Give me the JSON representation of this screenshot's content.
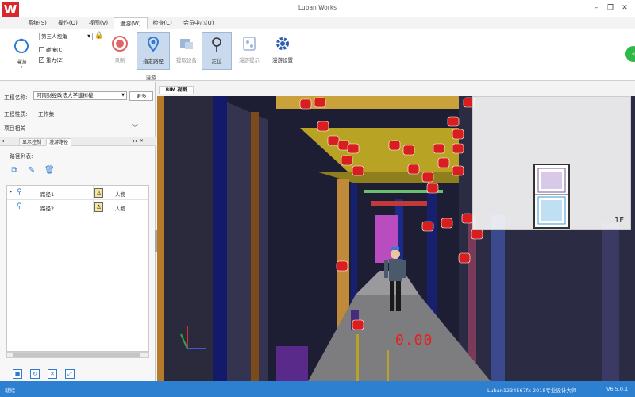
{
  "app": {
    "title": "Luban Works",
    "logo": "W"
  },
  "window_controls": {
    "minimize": "–",
    "restore": "❐",
    "close": "✕"
  },
  "menu": {
    "tabs": [
      {
        "label": "系统(S)"
      },
      {
        "label": "操作(O)"
      },
      {
        "label": "视图(V)"
      },
      {
        "label": "漫游(W)",
        "active": true
      },
      {
        "label": "检查(C)"
      },
      {
        "label": "会员中心(U)"
      }
    ]
  },
  "ribbon": {
    "roam_label": "漫游",
    "view_mode": "第三人视角",
    "collision_label": "碰撞(C)",
    "collision_checked": false,
    "gravity_label": "重力(Z)",
    "gravity_checked": true,
    "record_label": "录制",
    "set_path_label": "指定路径",
    "extract_device_label": "提取设备",
    "locate_label": "定位",
    "roam_hint_label": "漫游提示",
    "roam_settings_label": "漫游设置",
    "group_label": "漫游"
  },
  "left_panel": {
    "project_name_label": "工程名称:",
    "project_name_value": "河南财经政法大学建树楼",
    "more_label": "更多",
    "project_type_label": "工程性质:",
    "project_type_value": "工作集",
    "project_related_label": "项目相关",
    "tabs": [
      {
        "label": "显示控制"
      },
      {
        "label": "漫游路径",
        "active": true
      }
    ],
    "path_list_label": "路径列表:",
    "paths": [
      {
        "name": "路径1",
        "type": "人物"
      },
      {
        "name": "路径2",
        "type": "人物"
      }
    ]
  },
  "viewport": {
    "tab_label": "BIM 视图",
    "floor_label": "1F",
    "readout": "0.00"
  },
  "status": {
    "left": "就绪",
    "middle": "Luban1234567fx 2018专业设计大师",
    "right": "V6.5.0.1"
  },
  "colors": {
    "accent": "#2d7fcf",
    "alert_marker": "#d81e1e",
    "selected_ribbon": "#c9d9ee"
  }
}
